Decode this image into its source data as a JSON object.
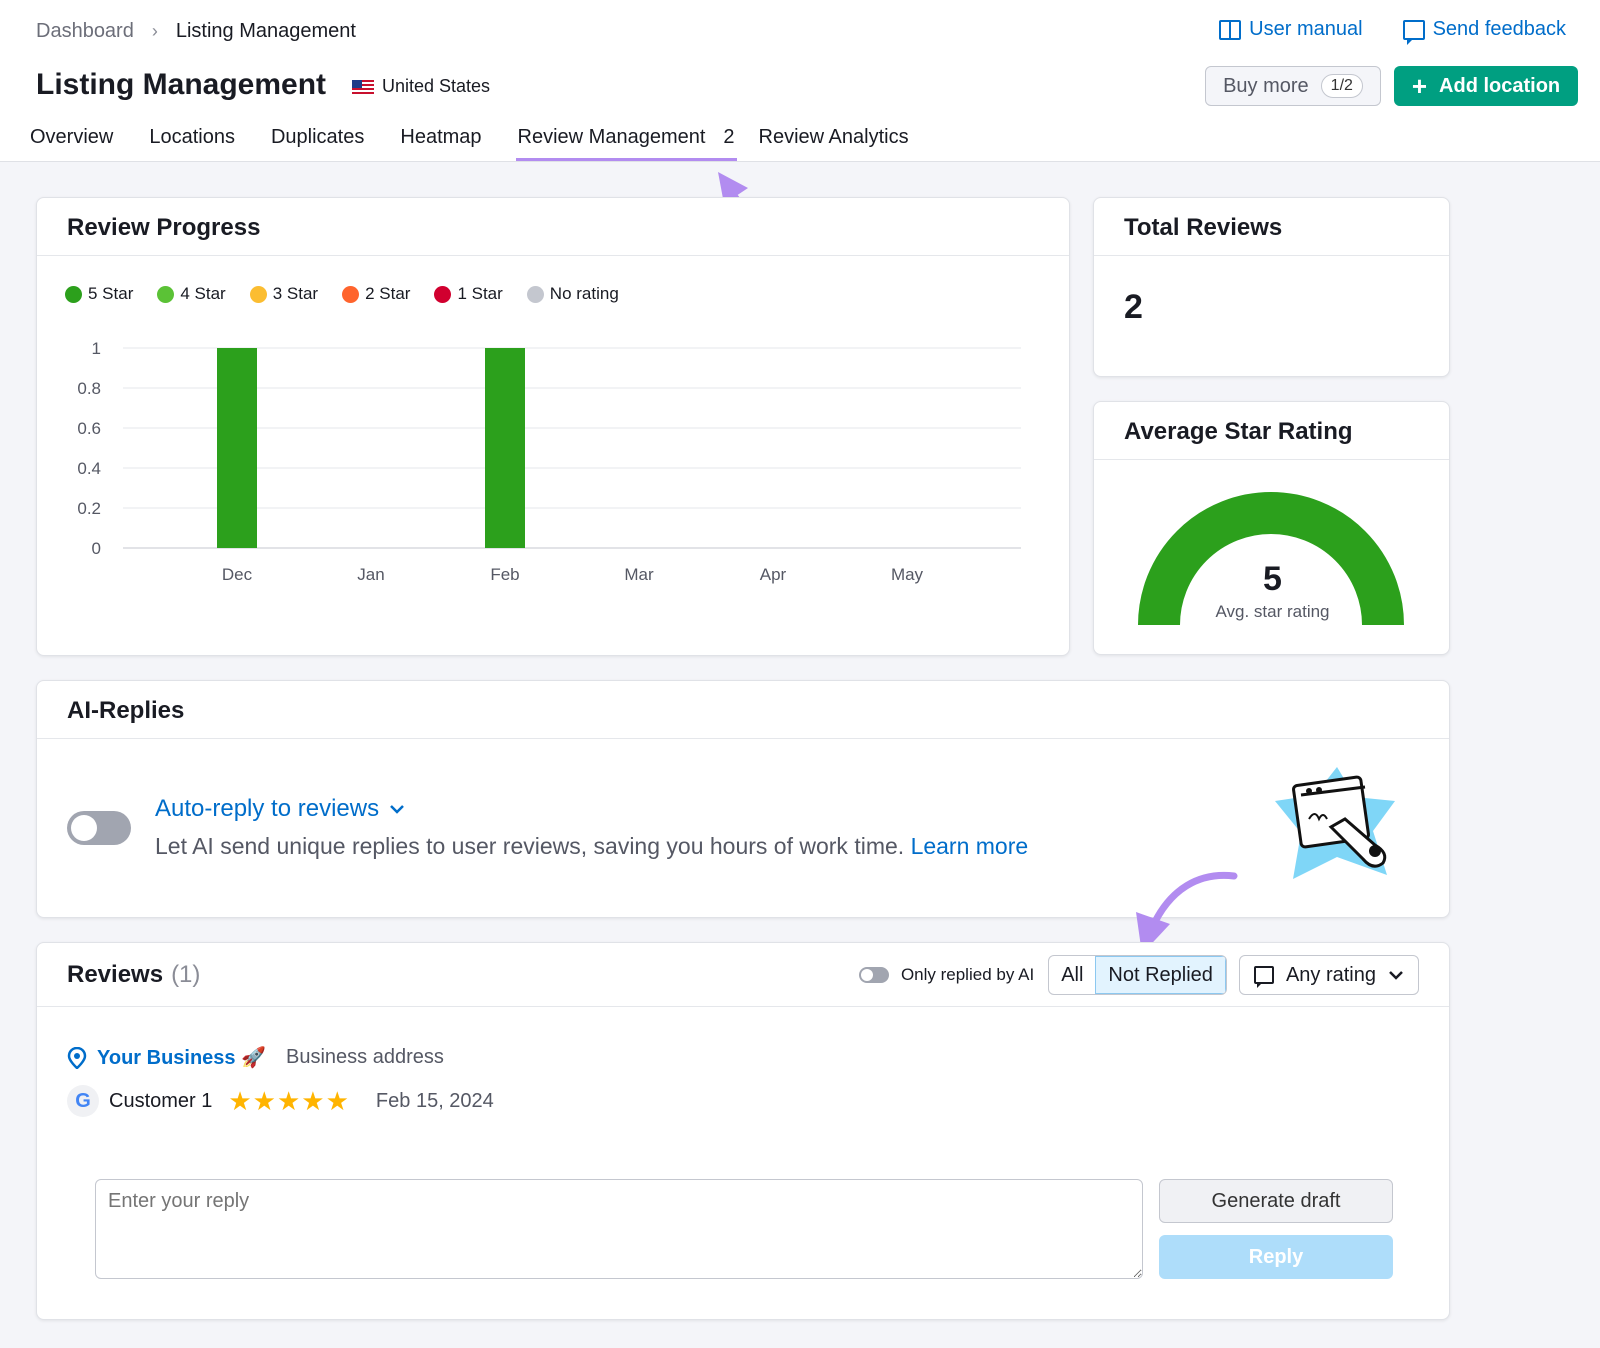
{
  "breadcrumbs": [
    "Dashboard",
    "Listing Management"
  ],
  "page_title": "Listing Management",
  "country": "United States",
  "top_links": {
    "manual": "User manual",
    "feedback": "Send feedback"
  },
  "buy_more": {
    "label": "Buy more",
    "count": "1/2"
  },
  "add_location": {
    "icon": "plus-icon",
    "label": "Add location"
  },
  "tabs": [
    {
      "label": "Overview"
    },
    {
      "label": "Locations"
    },
    {
      "label": "Duplicates"
    },
    {
      "label": "Heatmap"
    },
    {
      "label": "Review Management",
      "badge": "2",
      "active": true
    },
    {
      "label": "Review Analytics"
    }
  ],
  "review_progress": {
    "title": "Review Progress"
  },
  "chart_data": {
    "type": "bar",
    "title": "",
    "categories": [
      "Dec",
      "Jan",
      "Feb",
      "Mar",
      "Apr",
      "May"
    ],
    "series": [
      {
        "name": "5 Star",
        "color": "#2ca01c",
        "values": [
          1,
          0,
          1,
          0,
          0,
          0
        ]
      },
      {
        "name": "4 Star",
        "color": "#5bc236",
        "values": [
          0,
          0,
          0,
          0,
          0,
          0
        ]
      },
      {
        "name": "3 Star",
        "color": "#fbbd31",
        "values": [
          0,
          0,
          0,
          0,
          0,
          0
        ]
      },
      {
        "name": "2 Star",
        "color": "#ff642d",
        "values": [
          0,
          0,
          0,
          0,
          0,
          0
        ]
      },
      {
        "name": "1 Star",
        "color": "#d1002f",
        "values": [
          0,
          0,
          0,
          0,
          0,
          0
        ]
      },
      {
        "name": "No rating",
        "color": "#c4c7cf",
        "values": [
          0,
          0,
          0,
          0,
          0,
          0
        ]
      }
    ],
    "yticks": [
      "0",
      "0.2",
      "0.4",
      "0.6",
      "0.8",
      "1"
    ],
    "ylim": [
      0,
      1
    ],
    "stacked": true,
    "grid": true,
    "legend": "top-left"
  },
  "total_reviews": {
    "title": "Total Reviews",
    "value": "2"
  },
  "avg_rating": {
    "title": "Average Star Rating",
    "value": "5",
    "label": "Avg. star rating",
    "fraction": 1.0,
    "color": "#2ca01c"
  },
  "ai_replies": {
    "title": "AI-Replies",
    "toggle_title": "Auto-reply to reviews",
    "description": "Let AI send unique replies to user reviews, saving you hours of work time.",
    "learn_more": "Learn more"
  },
  "reviews": {
    "title": "Reviews",
    "count": "(1)",
    "only_ai_label": "Only replied by AI",
    "filter_all": "All",
    "filter_not_replied": "Not Replied",
    "rating_filter": "Any rating",
    "items": [
      {
        "business": "Your Business 🚀",
        "address": "Business address",
        "customer": "Customer 1",
        "source": "G",
        "rating": 5,
        "stars": "★★★★★",
        "date": "Feb 15, 2024"
      }
    ],
    "reply_placeholder": "Enter your reply",
    "generate_label": "Generate draft",
    "reply_label": "Reply"
  },
  "accent_colors": {
    "primary_link": "#006dca",
    "cta": "#009f81",
    "annotation": "#b28cf0"
  }
}
